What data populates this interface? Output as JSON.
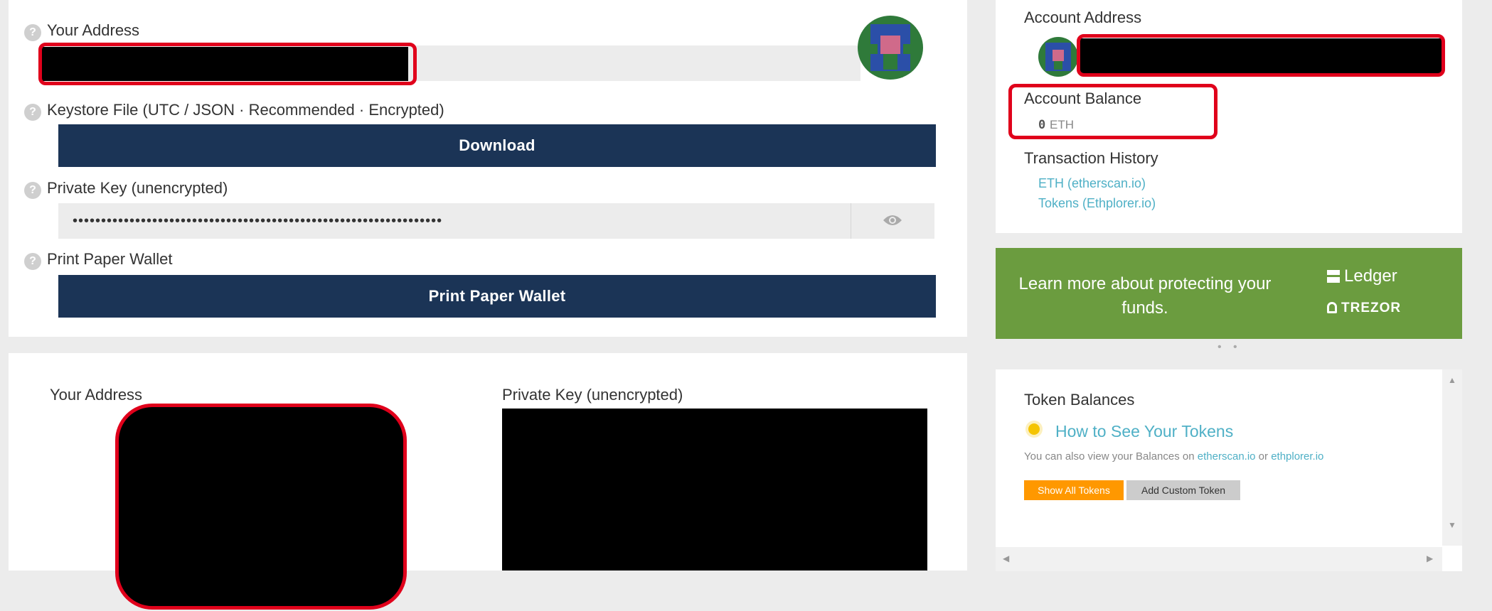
{
  "wallet": {
    "your_address_label": "Your Address",
    "keystore_label": "Keystore File (UTC / JSON · Recommended · Encrypted)",
    "download_label": "Download",
    "private_key_label": "Private Key (unencrypted)",
    "private_key_masked": "•••••••••••••••••••••••••••••••••••••••••••••••••••••••••••••••••",
    "print_label": "Print Paper Wallet",
    "print_button_label": "Print Paper Wallet"
  },
  "paper": {
    "your_address_label": "Your Address",
    "private_key_label": "Private Key (unencrypted)"
  },
  "account": {
    "address_label": "Account Address",
    "balance_label": "Account Balance",
    "balance_value": "0",
    "balance_unit": "ETH",
    "history_label": "Transaction History",
    "history_links": [
      "ETH (etherscan.io)",
      "Tokens (Ethplorer.io)"
    ]
  },
  "banner": {
    "text": "Learn more about protecting your funds.",
    "brand_ledger": "Ledger",
    "brand_trezor": "TREZOR",
    "dots": "• •"
  },
  "tokens": {
    "title": "Token Balances",
    "how_to": "How to See Your Tokens",
    "info_prefix": "You can also view your Balances on",
    "link_etherscan": "etherscan.io",
    "info_or": "or",
    "link_ethplorer": "ethplorer.io",
    "show_all": "Show All Tokens",
    "add_custom": "Add Custom Token"
  },
  "colors": {
    "navy": "#1b3456",
    "green": "#6b9c3f",
    "link": "#4fb0c6",
    "orange": "#ff9800",
    "red_highlight": "#e0001b"
  },
  "icons": [
    "help-icon",
    "eye-icon",
    "identicon",
    "lightbulb-icon",
    "ledger-icon",
    "trezor-lock-icon",
    "scroll-up-arrow",
    "scroll-down-arrow",
    "scroll-left-arrow",
    "scroll-right-arrow"
  ]
}
